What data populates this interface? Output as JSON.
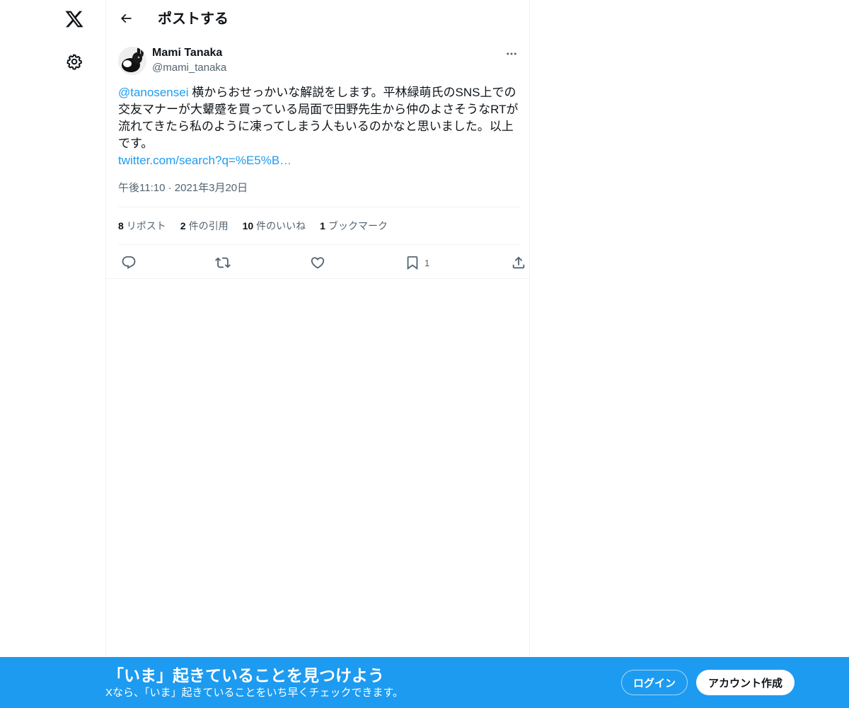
{
  "nav": {
    "logo_icon": "x-logo-icon",
    "settings_icon": "gear-icon"
  },
  "header": {
    "title": "ポストする",
    "back_icon": "arrow-left-icon"
  },
  "post": {
    "author": {
      "name": "Mami Tanaka",
      "handle": "@mami_tanaka"
    },
    "mention": "@tanosensei",
    "text": " 横からおせっかいな解説をします。平林緑萌氏のSNS上での交友マナーが大顰蹙を買っている局面で田野先生から仲のよさそうなRTが流れてきたら私のように凍ってしまう人もいるのかなと思いました。以上です。",
    "link": "twitter.com/search?q=%E5%B…",
    "timestamp": "午後11:10 · 2021年3月20日",
    "stats": [
      {
        "count": "8",
        "label": "リポスト"
      },
      {
        "count": "2",
        "label": "件の引用"
      },
      {
        "count": "10",
        "label": "件のいいね"
      },
      {
        "count": "1",
        "label": "ブックマーク"
      }
    ],
    "actions": {
      "reply_icon": "reply-icon",
      "repost_icon": "repost-icon",
      "like_icon": "heart-icon",
      "bookmark_icon": "bookmark-icon",
      "bookmark_count": "1",
      "share_icon": "share-icon"
    }
  },
  "banner": {
    "title": "「いま」起きていることを見つけよう",
    "subtitle": "Xなら、「いま」起きていることをいち早くチェックできます。",
    "login_label": "ログイン",
    "signup_label": "アカウント作成"
  },
  "colors": {
    "accent": "#1d9bf0",
    "text": "#0f1419",
    "secondary": "#536471",
    "border": "#eff3f4"
  }
}
